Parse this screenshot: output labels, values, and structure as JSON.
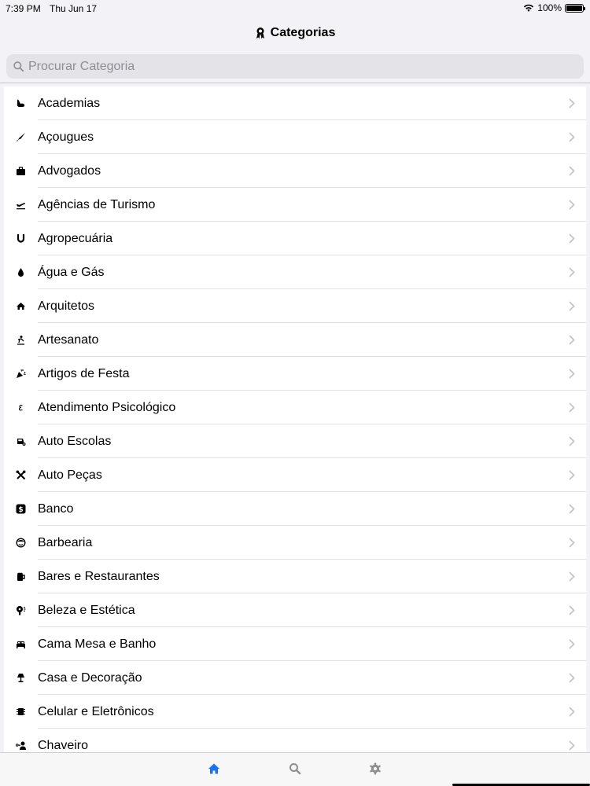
{
  "status_bar": {
    "time": "7:39 PM",
    "date": "Thu Jun 17",
    "battery": "100%"
  },
  "nav": {
    "title": "Categorias",
    "icon": "award-icon"
  },
  "search": {
    "placeholder": "Procurar Categoria",
    "value": ""
  },
  "categories": [
    {
      "label": "Academias",
      "icon": "dumbbell-icon"
    },
    {
      "label": "Açougues",
      "icon": "knife-icon"
    },
    {
      "label": "Advogados",
      "icon": "briefcase-icon"
    },
    {
      "label": "Agências de Turismo",
      "icon": "plane-departure-icon"
    },
    {
      "label": "Agropecuária",
      "icon": "horseshoe-icon"
    },
    {
      "label": "Água e Gás",
      "icon": "drop-icon"
    },
    {
      "label": "Arquitetos",
      "icon": "house-tools-icon"
    },
    {
      "label": "Artesanato",
      "icon": "pottery-icon"
    },
    {
      "label": "Artigos de Festa",
      "icon": "party-popper-icon"
    },
    {
      "label": "Atendimento Psicológico",
      "icon": "psi-icon"
    },
    {
      "label": "Auto Escolas",
      "icon": "car-steering-icon"
    },
    {
      "label": "Auto Peças",
      "icon": "wrench-screwdriver-icon"
    },
    {
      "label": "Banco",
      "icon": "dollar-square-icon"
    },
    {
      "label": "Barbearia",
      "icon": "face-icon"
    },
    {
      "label": "Bares e Restaurantes",
      "icon": "beer-mug-icon"
    },
    {
      "label": "Beleza e Estética",
      "icon": "hair-dryer-icon"
    },
    {
      "label": "Cama Mesa e Banho",
      "icon": "bed-icon"
    },
    {
      "label": "Casa e Decoração",
      "icon": "lamp-icon"
    },
    {
      "label": "Celular e Eletrônicos",
      "icon": "chip-icon"
    },
    {
      "label": "Chaveiro",
      "icon": "key-person-icon"
    }
  ],
  "tab_bar": {
    "items": [
      "home-icon",
      "search-icon",
      "gear-icon"
    ],
    "active_color": "#1a73e8",
    "inactive_color": "#8e8e93"
  }
}
